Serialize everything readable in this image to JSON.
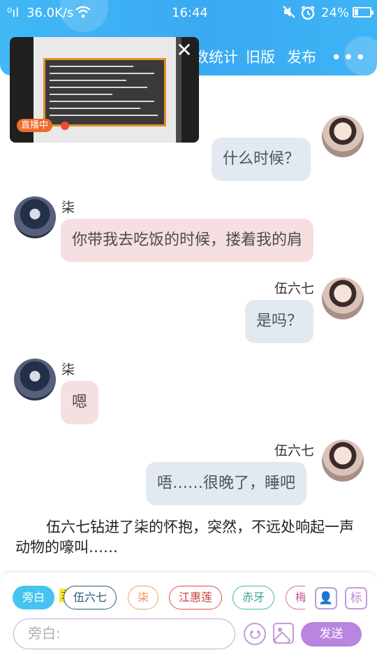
{
  "status_bar": {
    "net_speed": "36.0K/s",
    "time": "16:44",
    "battery": "24%",
    "battery_level": 0.24
  },
  "header": {
    "stats_label": "数统计",
    "old_version_label": "旧版",
    "publish_label": "发布",
    "more_label": "•••"
  },
  "live_overlay": {
    "badge": "直播中",
    "close_label": "✕"
  },
  "chat": [
    {
      "speaker": "伍六七",
      "text": "什么时候？",
      "side": "right",
      "name_visible": false
    },
    {
      "speaker": "柒",
      "text": "你带我去吃饭的时候，搂着我的肩",
      "side": "left",
      "name_visible": true
    },
    {
      "speaker": "伍六七",
      "text": "是吗？",
      "side": "right",
      "name_visible": true
    },
    {
      "speaker": "柒",
      "text": "嗯",
      "side": "left",
      "name_visible": true
    },
    {
      "speaker": "伍六七",
      "text": "唔……很晚了，睡吧",
      "side": "right",
      "name_visible": true
    }
  ],
  "narration": "伍六七钻进了柒的怀抱，突然，不远处响起一声动物的嚎叫……",
  "composer": {
    "roles": [
      "旁白",
      "伍六七",
      "柒",
      "江惠莲",
      "赤牙",
      "梅"
    ],
    "main_tag": "主",
    "role_button": "👤",
    "mark_button": "标",
    "input_placeholder": "旁白:",
    "send_label": "发送"
  },
  "colors": {
    "header_blue": "#3aa9f2",
    "send_purple": "#b885e0",
    "right_bubble": "#e3e9f1",
    "left_bubble": "#f5dfe1"
  }
}
